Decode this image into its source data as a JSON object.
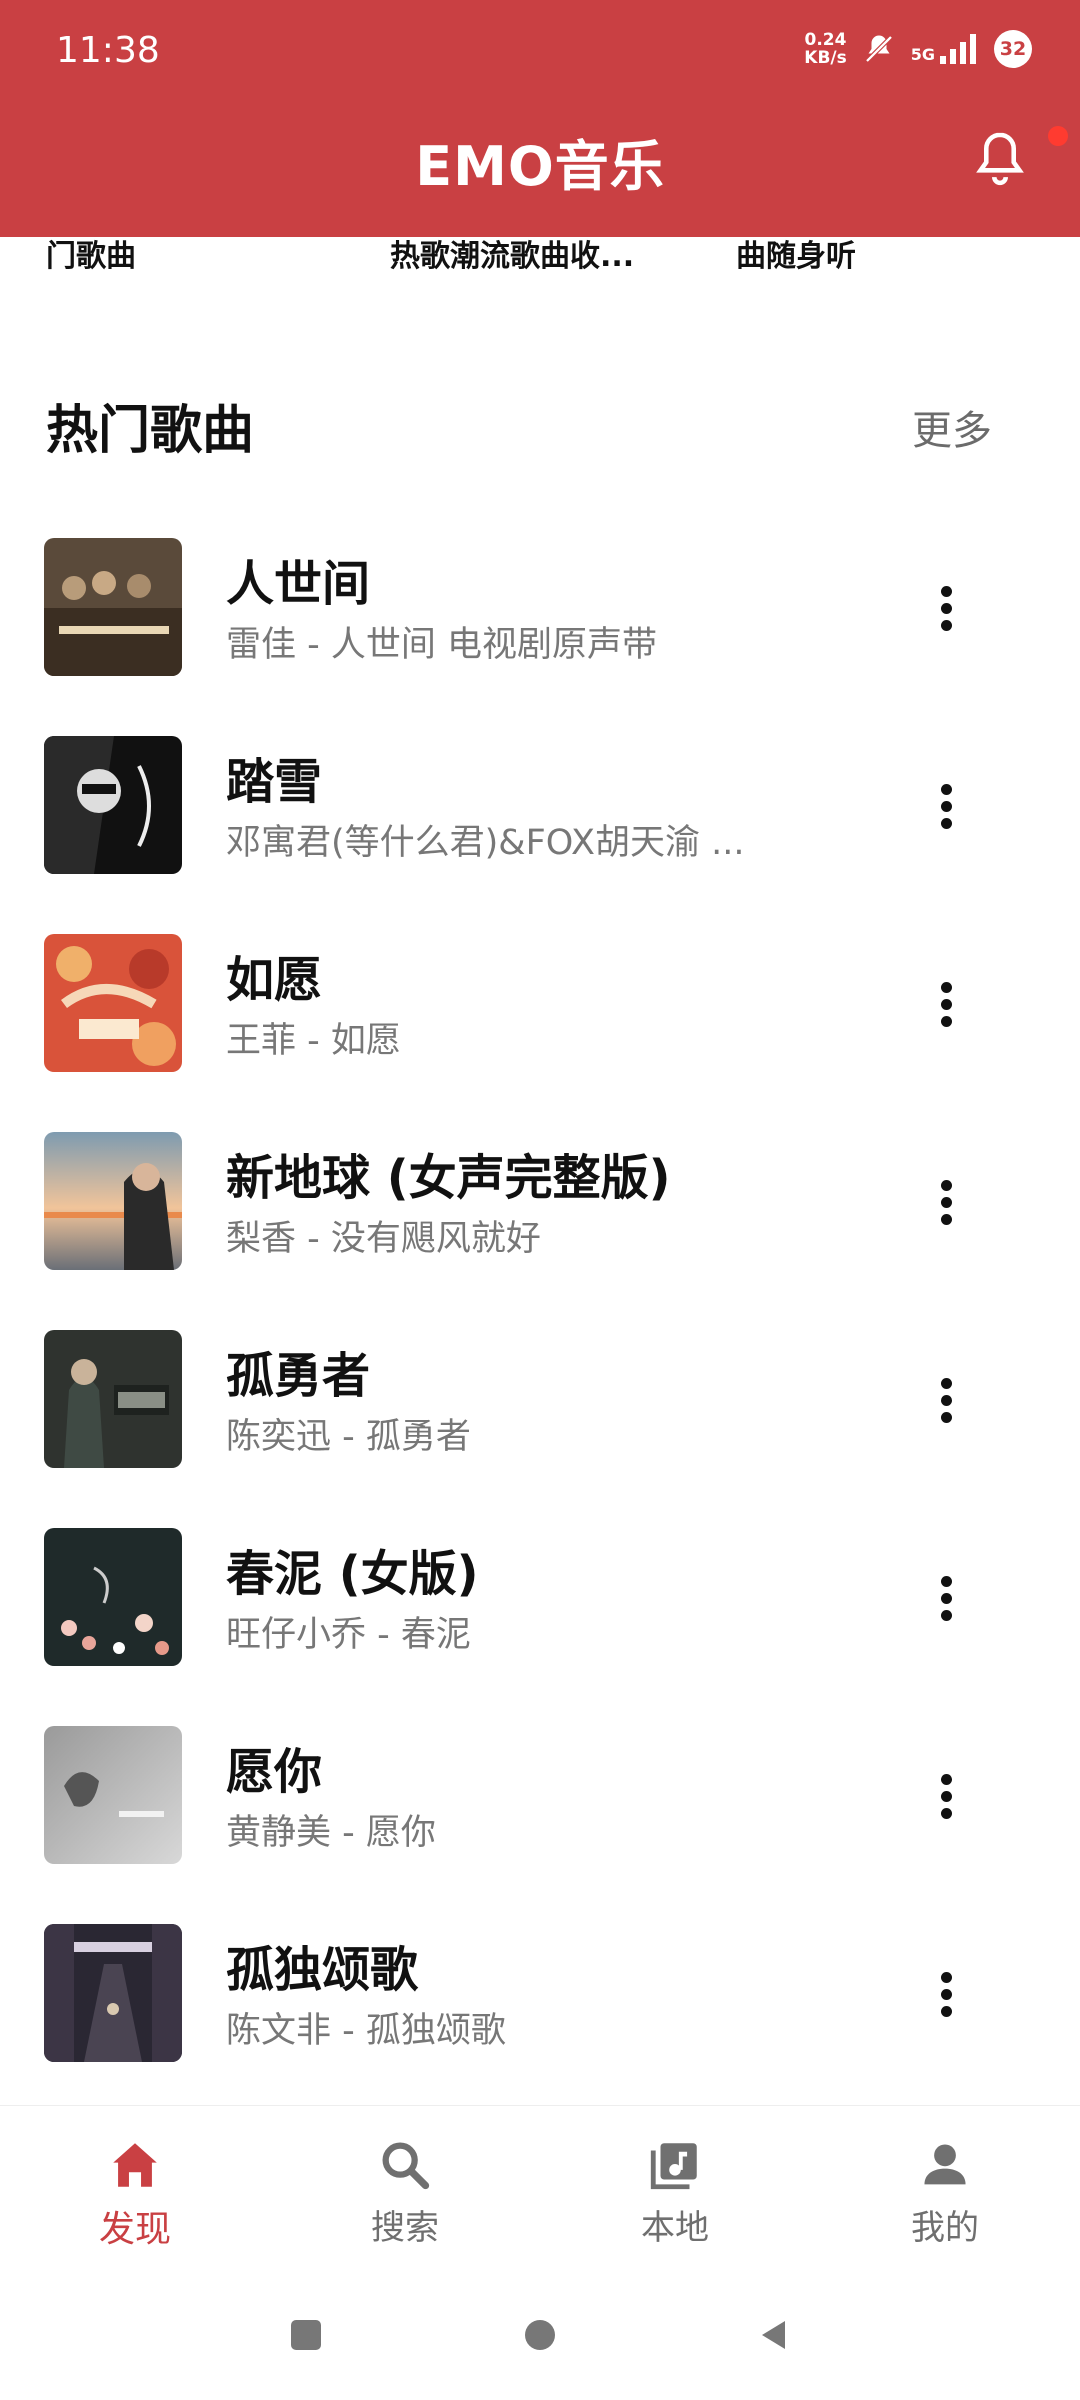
{
  "status_bar": {
    "time": "11:38",
    "net_speed_value": "0.24",
    "net_speed_unit": "KB/s",
    "network": "5G",
    "battery": "32"
  },
  "header": {
    "title": "EMO音乐",
    "accent_color": "#c94043",
    "notification_dot": true
  },
  "previous_section_cut": [
    {
      "line2": "门歌曲"
    },
    {
      "line2": "热歌潮流歌曲收..."
    },
    {
      "line2": "曲随身听"
    }
  ],
  "hot_songs": {
    "title": "热门歌曲",
    "more": "更多",
    "items": [
      {
        "title": "人世间",
        "subtitle": "雷佳 - 人世间 电视剧原声带"
      },
      {
        "title": "踏雪",
        "subtitle": "邓寓君(等什么君)&FOX胡天渝 ..."
      },
      {
        "title": "如愿",
        "subtitle": "王菲 - 如愿"
      },
      {
        "title": "新地球 (女声完整版)",
        "subtitle": "梨香 - 没有飓风就好"
      },
      {
        "title": "孤勇者",
        "subtitle": "陈奕迅 - 孤勇者"
      },
      {
        "title": "春泥 (女版)",
        "subtitle": "旺仔小乔 - 春泥"
      },
      {
        "title": "愿你",
        "subtitle": "黄静美 - 愿你"
      },
      {
        "title": "孤独颂歌",
        "subtitle": "陈文非 - 孤独颂歌"
      }
    ]
  },
  "bottom_nav": {
    "items": [
      {
        "label": "发现",
        "icon": "home-icon",
        "active": true
      },
      {
        "label": "搜索",
        "icon": "search-icon",
        "active": false
      },
      {
        "label": "本地",
        "icon": "music-library-icon",
        "active": false
      },
      {
        "label": "我的",
        "icon": "person-icon",
        "active": false
      }
    ]
  }
}
